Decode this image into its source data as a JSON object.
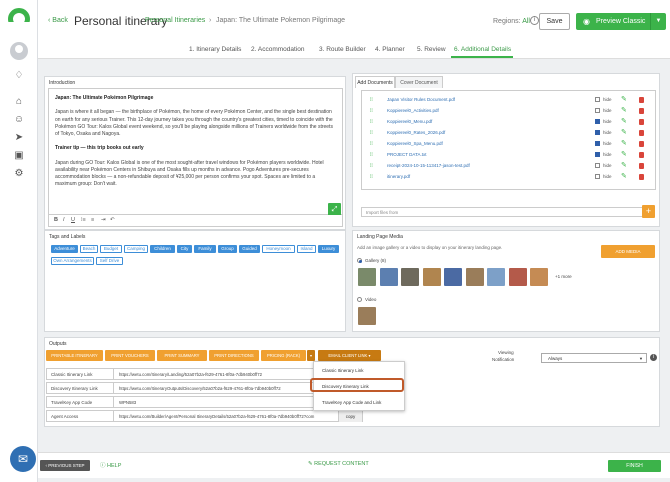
{
  "header": {
    "back_label": "Back",
    "title": "Personal itinerary",
    "breadcrumb_1": "Personal Itineraries",
    "breadcrumb_sep": "›",
    "breadcrumb_2": "Japan: The Ultimate Pokemon Pilgrimage",
    "regions_label": "Regions:",
    "regions_value": "All",
    "save_label": "Save",
    "preview_label": "Preview Classic"
  },
  "steps": [
    {
      "label": "1. Itinerary Details"
    },
    {
      "label": "2. Accommodation"
    },
    {
      "label": "3. Route Builder"
    },
    {
      "label": "4. Planner"
    },
    {
      "label": "5. Review"
    },
    {
      "label": "6. Additional Details",
      "active": true
    }
  ],
  "intro": {
    "panel_title": "Introduction",
    "heading": "Japan: The Ultimate Pokémon Pilgrimage",
    "paragraph_1": "Japan is where it all began — the birthplace of Pokémon, the home of every Pokémon Center, and the single best destination on earth for any serious Trainer. This 12-day journey takes you through the country's greatest cities, timed to coincide with the Pokémon GO Tour: Kalos Global event weekend, so you'll be playing alongside millions of Trainers worldwide from the streets of Tokyo, Osaka and Nagoya.",
    "subheading": "Trainer tip — this trip books out early",
    "paragraph_2": "Japan during GO Tour: Kalos Global is one of the most sought-after travel windows for Pokémon players worldwide. Hotel availability near Pokémon Centers in Shibuya and Osaka fills up months in advance. Pogo Adventures pre-secures accommodation blocks — a non-refundable deposit of ¥25,000 per person confirms your spot. Spaces are limited to a maximum group: Don't wait.",
    "toolbar": [
      "B",
      "I",
      "U",
      "⁞≡",
      "≡",
      "⇥",
      "↶"
    ]
  },
  "documents": {
    "tab_add": "Add Documents",
    "tab_cover": "Cover Document",
    "hide_label": "hide",
    "files": [
      {
        "name": "Japan Visitor Rules Document.pdf",
        "hidden": false
      },
      {
        "name": "Koppiereel0_Activities.pdf",
        "hidden": false
      },
      {
        "name": "Koppiereel0_Menu.pdf",
        "hidden": true
      },
      {
        "name": "Koppiereel0_Rates_2026.pdf",
        "hidden": true
      },
      {
        "name": "Koppiereel0_Spa_Menu.pdf",
        "hidden": true
      },
      {
        "name": "PROJECT DATA.txt",
        "hidden": true
      },
      {
        "name": "receipt-2024-10-15-113417-jason-test.pdf",
        "hidden": false
      },
      {
        "name": "itinerary.pdf",
        "hidden": false
      }
    ],
    "import_placeholder": "Import files from"
  },
  "tags": {
    "panel_title": "Tags and Labels",
    "items": [
      {
        "label": "Adventure",
        "on": true
      },
      {
        "label": "Beach",
        "on": false
      },
      {
        "label": "Budget",
        "on": false
      },
      {
        "label": "Camping",
        "on": false
      },
      {
        "label": "Children",
        "on": true
      },
      {
        "label": "City",
        "on": true
      },
      {
        "label": "Family",
        "on": true
      },
      {
        "label": "Group",
        "on": true
      },
      {
        "label": "Guided",
        "on": true
      },
      {
        "label": "Honeymoon",
        "on": false
      },
      {
        "label": "Island",
        "on": false
      },
      {
        "label": "Luxury",
        "on": true
      },
      {
        "label": "Own Arrangements",
        "on": false
      },
      {
        "label": "Self Drive",
        "on": false
      }
    ]
  },
  "landing": {
    "panel_title": "Landing Page Media",
    "subtitle": "Add an image gallery or a video to display on your itinerary landing page.",
    "add_media": "ADD MEDIA",
    "gallery_label": "Gallery (8)",
    "more_label": "+1 more",
    "video_label": "Video",
    "thumb_colors": [
      "#7a8a6a",
      "#5c7fb0",
      "#6e6a5d",
      "#b0854f",
      "#4b6aa3",
      "#9a7d5a",
      "#7da0c8",
      "#b45a4a",
      "#c58b54"
    ]
  },
  "outputs": {
    "panel_title": "Outputs",
    "buttons": [
      "PRINTABLE ITINERARY",
      "PRINT VOUCHERS",
      "PRINT SUMMARY",
      "PRINT DIRECTIONS",
      "PRICING (RACK)",
      "▾",
      "EMAIL CLIENT LINK ▾"
    ],
    "rows": [
      {
        "label": "Classic Itinerary Link",
        "value": "https://wetu.com/Itinerary/Landing/52a07b2a-f629-4761-8f0a-7db940b0ff72",
        "action": ""
      },
      {
        "label": "Discovery Itinerary Link",
        "value": "https://wetu.com/ItineraryOutputs/Discovery/52a07b2a-f629-4761-8f0a-7db940b0ff72",
        "action": ""
      },
      {
        "label": "TravelKey App Code",
        "value": "WPN583",
        "action": ""
      },
      {
        "label": "Agent Access",
        "value": "https://wetu.com/Builder/Agent/Personal ItineraryDetails/52a07b2a-f629-4761-8f0a-7db940b0ff72?com",
        "action": "copy"
      }
    ],
    "dropdown": [
      "Classic Itinerary Link",
      "Discovery Itinerary Link",
      "TravelKey App Code and Link"
    ],
    "viewing_label_1": "Viewing",
    "viewing_label_2": "Notification",
    "viewing_value": "Always"
  },
  "footer": {
    "prev": "PREVIOUS STEP",
    "help": "HELP",
    "request": "REQUEST CONTENT",
    "finish": "FINISH"
  },
  "colors": {
    "accent": "#3cb34a",
    "orange": "#f0a030",
    "blue_tag": "#3d8ed8",
    "highlight": "#c05a2a"
  }
}
